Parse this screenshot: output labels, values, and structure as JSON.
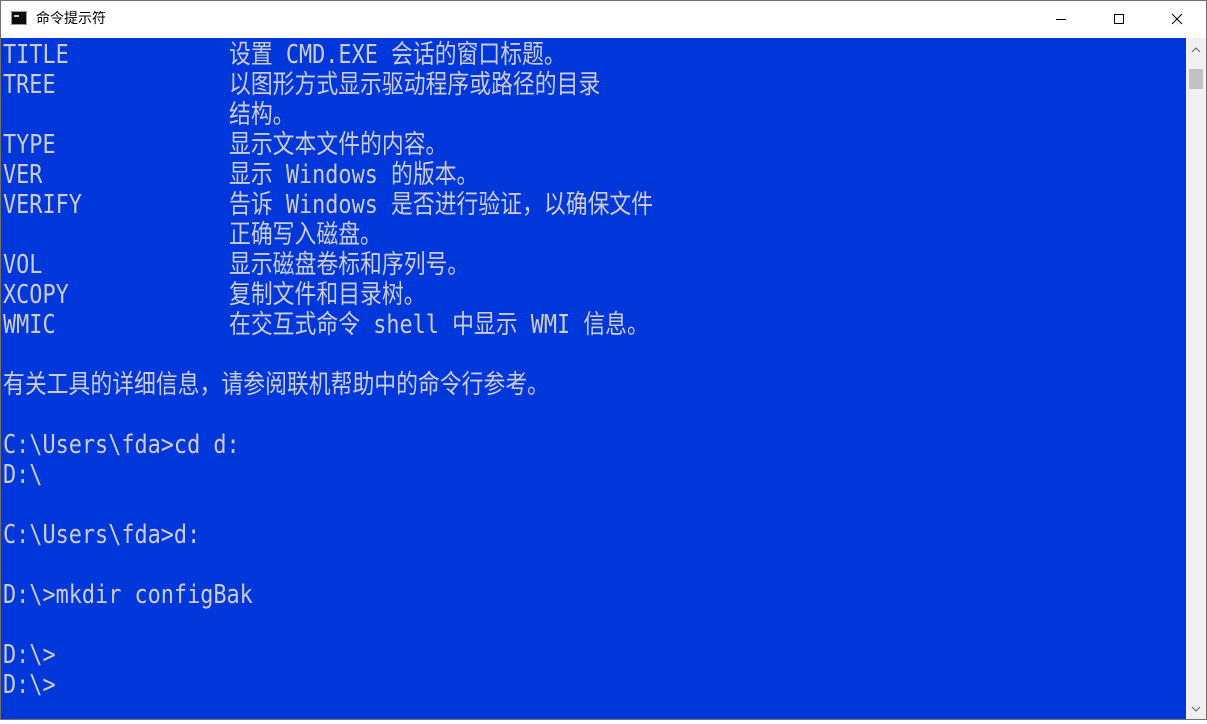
{
  "window": {
    "title": "命令提示符",
    "icon": "cmd-console-icon",
    "controls": {
      "minimize": "minimize-icon",
      "maximize": "maximize-icon",
      "close": "close-icon"
    }
  },
  "console": {
    "background": "#0037da",
    "foreground": "#cccccc",
    "help_rows": [
      {
        "cmd": "TITLE",
        "desc": "设置 CMD.EXE 会话的窗口标题。"
      },
      {
        "cmd": "TREE",
        "desc": "以图形方式显示驱动程序或路径的目录"
      },
      {
        "cmd": "",
        "desc": "结构。"
      },
      {
        "cmd": "TYPE",
        "desc": "显示文本文件的内容。"
      },
      {
        "cmd": "VER",
        "desc": "显示 Windows 的版本。"
      },
      {
        "cmd": "VERIFY",
        "desc": "告诉 Windows 是否进行验证，以确保文件"
      },
      {
        "cmd": "",
        "desc": "正确写入磁盘。"
      },
      {
        "cmd": "VOL",
        "desc": "显示磁盘卷标和序列号。"
      },
      {
        "cmd": "XCOPY",
        "desc": "复制文件和目录树。"
      },
      {
        "cmd": "WMIC",
        "desc": "在交互式命令 shell 中显示 WMI 信息。"
      }
    ],
    "lines": [
      "有关工具的详细信息，请参阅联机帮助中的命令行参考。",
      "C:\\Users\\fda>cd d:",
      "D:\\",
      "C:\\Users\\fda>d:",
      "D:\\>mkdir configBak",
      "D:\\>",
      "D:\\>"
    ]
  }
}
